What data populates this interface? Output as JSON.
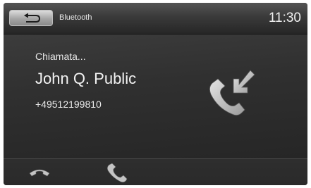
{
  "header": {
    "back_icon": "return-arrow-icon",
    "title": "Bluetooth",
    "time": "11:30"
  },
  "call": {
    "status": "Chiamata...",
    "contact_name": "John Q. Public",
    "phone_number": "+49512199810",
    "status_icon": "incoming-call-icon"
  },
  "footer": {
    "buttons": [
      {
        "icon": "hang-up-icon"
      },
      {
        "icon": "accept-call-icon"
      }
    ]
  },
  "colors": {
    "background": "#1b1b1b",
    "header": "#3a3a3a",
    "text": "#f0f0f0",
    "icon": "#c4c4c4"
  }
}
